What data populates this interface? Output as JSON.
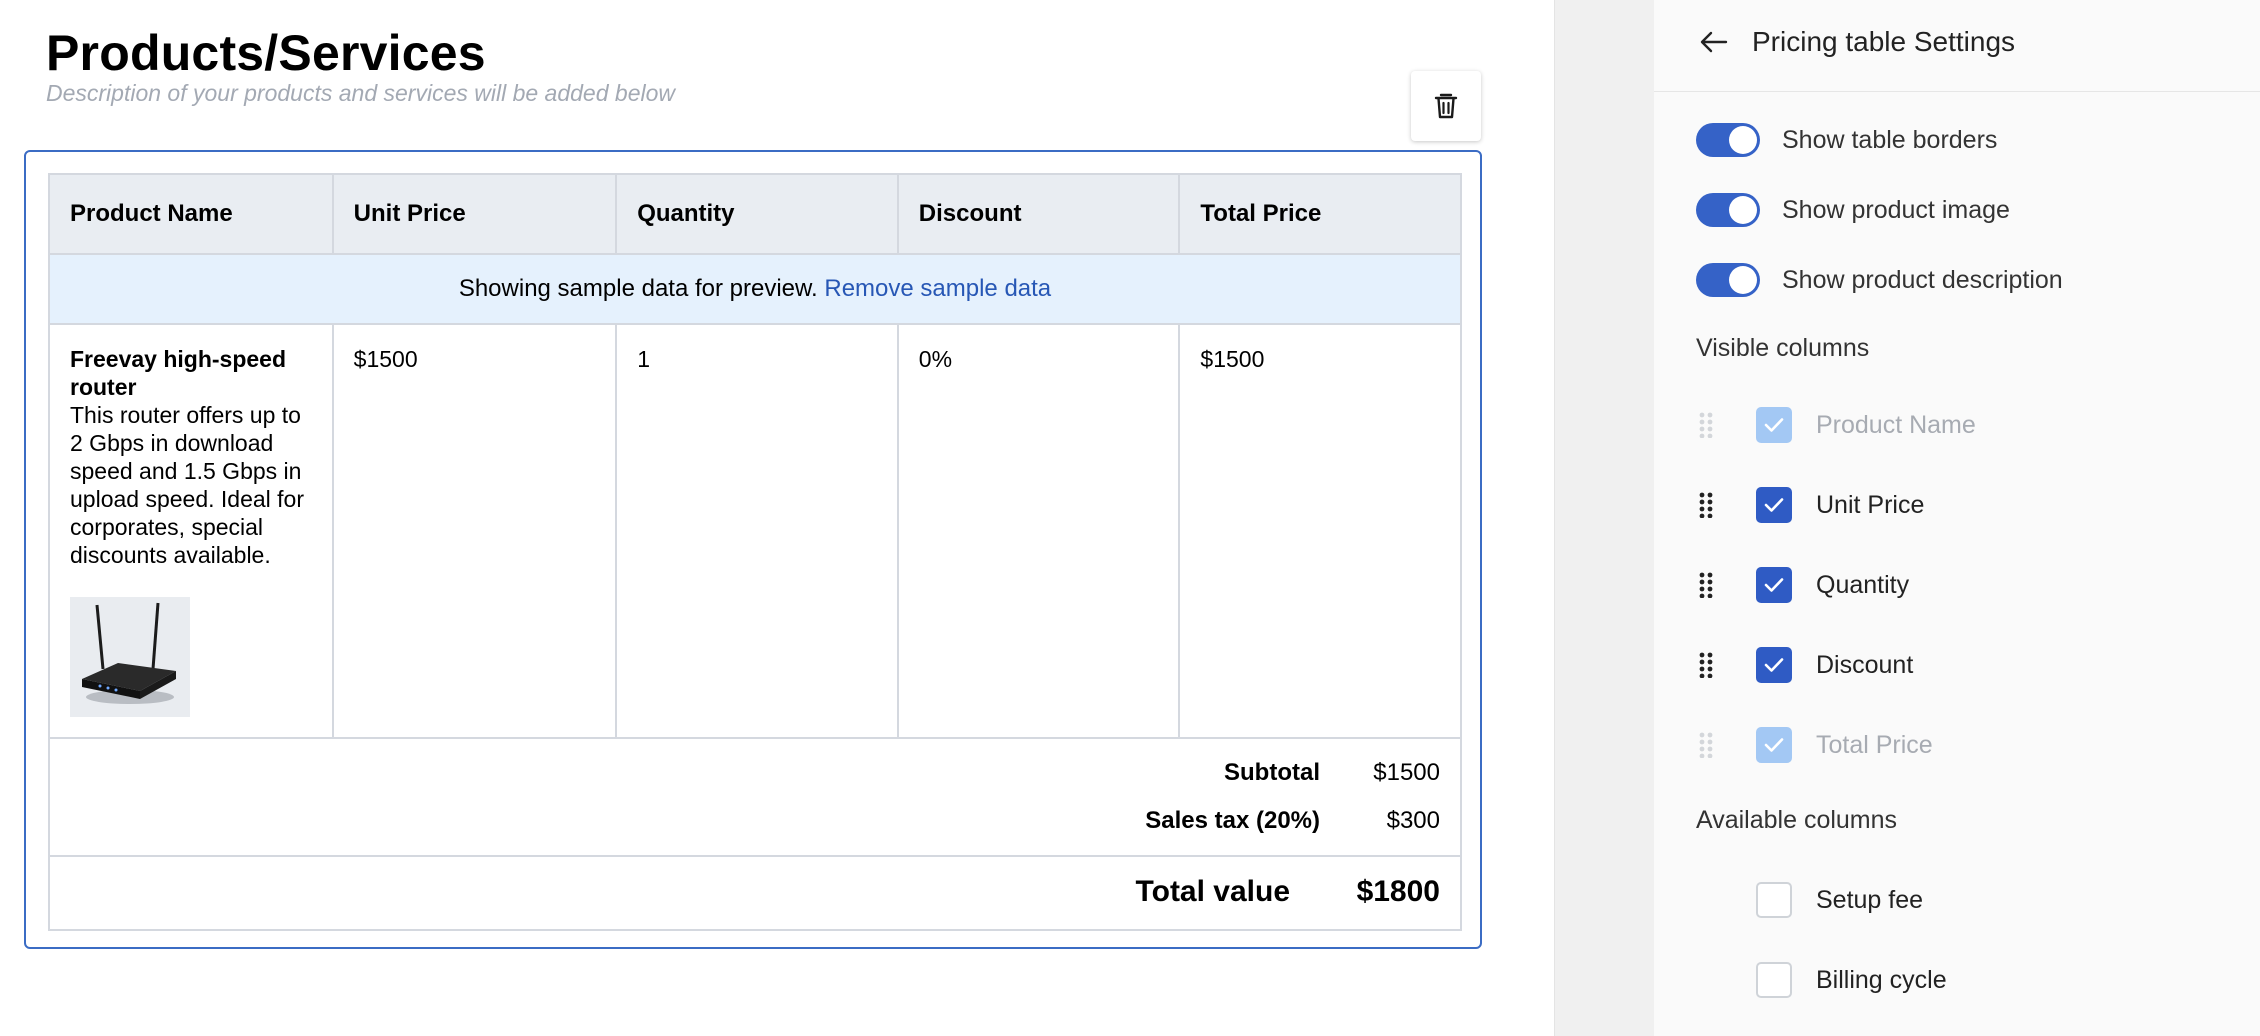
{
  "editor": {
    "title": "Products/Services",
    "subtitle": "Description of your products and services will be added below"
  },
  "table": {
    "headers": [
      "Product Name",
      "Unit Price",
      "Quantity",
      "Discount",
      "Total Price"
    ],
    "notice": {
      "text": "Showing sample data for preview.",
      "link": "Remove sample data"
    },
    "item": {
      "name": "Freevay high-speed router",
      "description": "This router offers up to 2 Gbps in download speed and 1.5 Gbps in upload speed. Ideal for corporates, special discounts available.",
      "image_icon": "router-image",
      "unit_price": "$1500",
      "quantity": "1",
      "discount": "0%",
      "total_price": "$1500"
    },
    "subtotal_label": "Subtotal",
    "subtotal_value": "$1500",
    "tax_label": "Sales tax (20%)",
    "tax_value": "$300",
    "total_label": "Total value",
    "total_value": "$1800"
  },
  "panel": {
    "title": "Pricing table Settings",
    "toggles": [
      {
        "label": "Show table borders",
        "on": true
      },
      {
        "label": "Show product image",
        "on": true
      },
      {
        "label": "Show product description",
        "on": true
      }
    ],
    "visible_heading": "Visible columns",
    "visible_columns": [
      {
        "label": "Product Name",
        "checked": true,
        "locked": true
      },
      {
        "label": "Unit Price",
        "checked": true,
        "locked": false
      },
      {
        "label": "Quantity",
        "checked": true,
        "locked": false
      },
      {
        "label": "Discount",
        "checked": true,
        "locked": false
      },
      {
        "label": "Total Price",
        "checked": true,
        "locked": true
      }
    ],
    "available_heading": "Available columns",
    "available_columns": [
      {
        "label": "Setup fee",
        "checked": false
      },
      {
        "label": "Billing cycle",
        "checked": false
      }
    ]
  },
  "colors": {
    "accent": "#3562c7",
    "border_active": "#3b6cc4",
    "notice_bg": "#e5f1fd",
    "link": "#2757b5"
  }
}
